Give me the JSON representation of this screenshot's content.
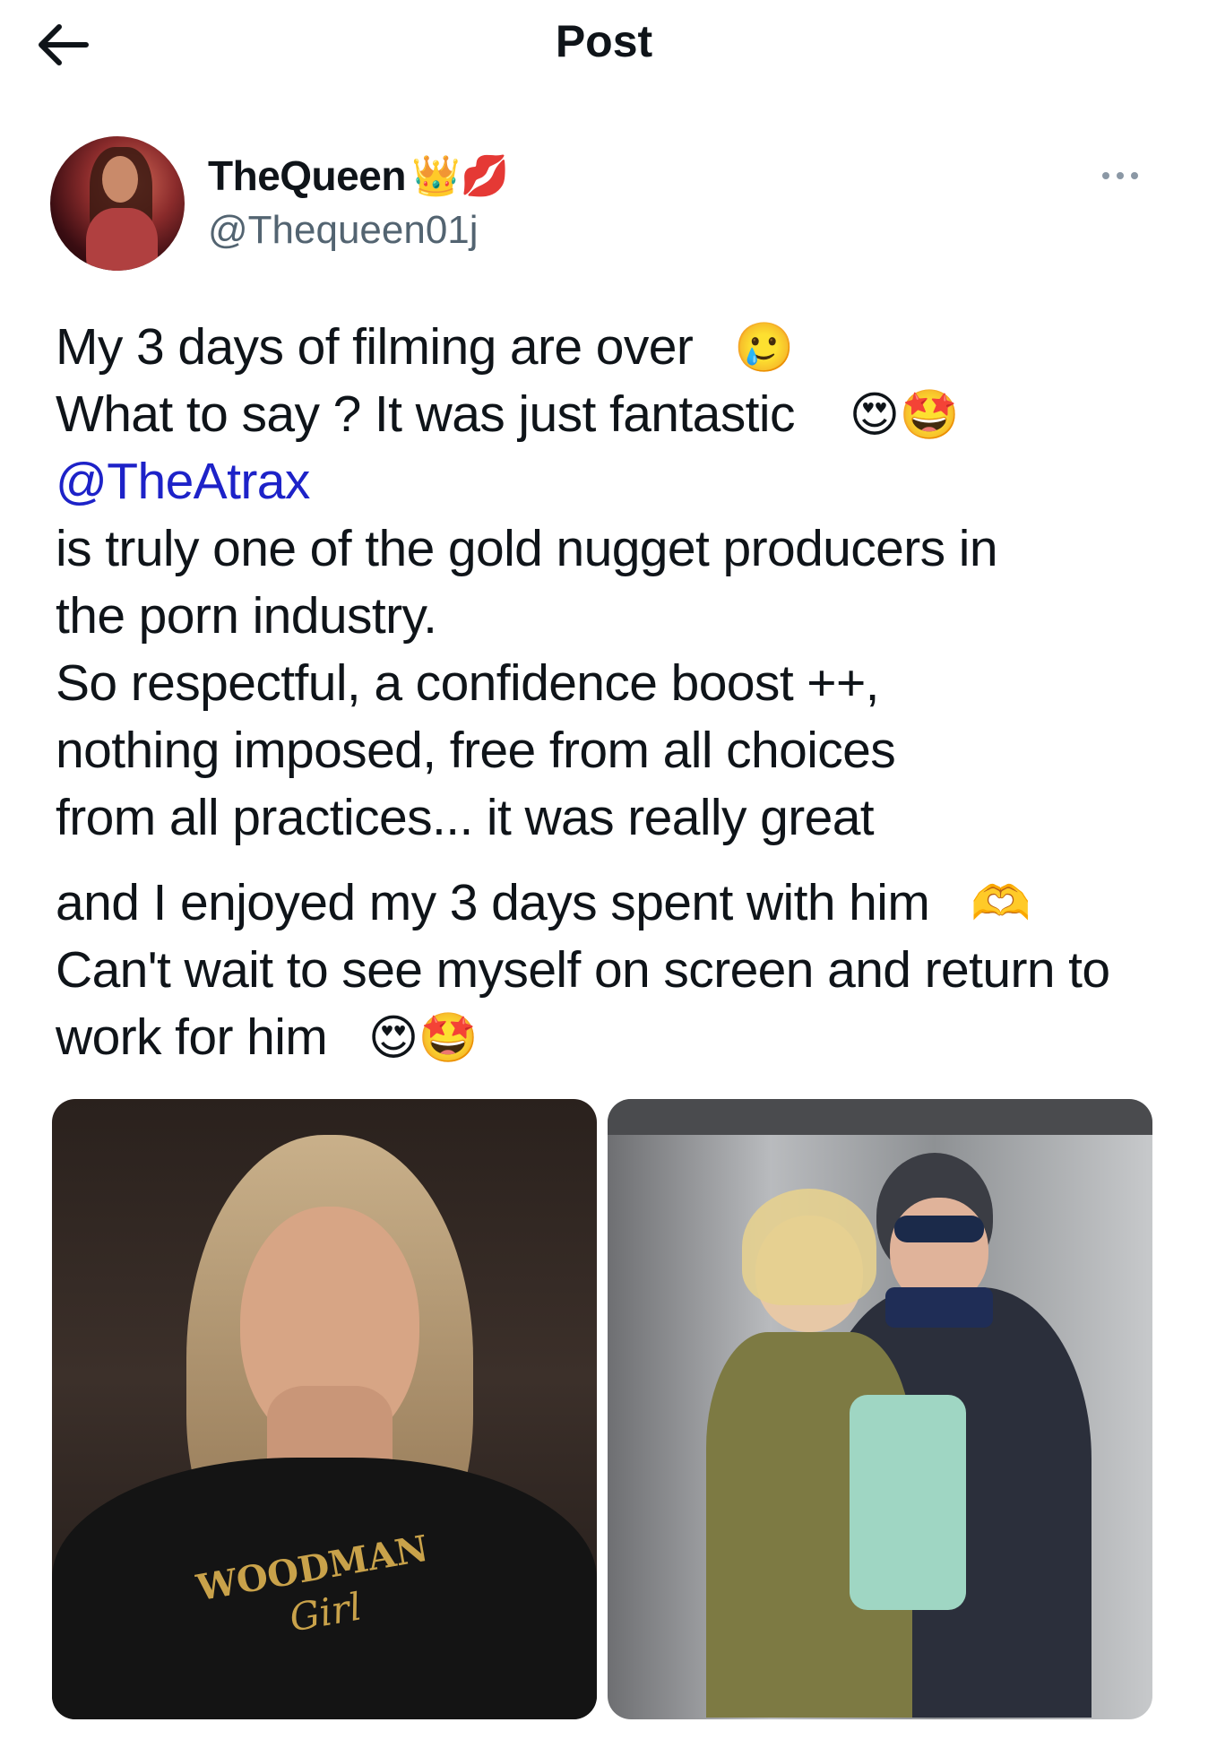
{
  "header": {
    "title": "Post",
    "back_icon": "arrow-left-icon"
  },
  "author": {
    "name": "TheQueen",
    "name_emojis": "👑💋",
    "handle": "@Thequeen01j",
    "more_icon": "more-horizontal-icon"
  },
  "post": {
    "lines": {
      "l1": "My 3 days of filming are over",
      "l1_emoji": "🥲",
      "l2": "What to say ? It was just fantastic",
      "l2_emoji": "😍🤩",
      "mention": "@TheAtrax",
      "l4": "is truly one of the gold nugget producers in",
      "l5": "the porn industry.",
      "l6": "So respectful, a confidence boost ++,",
      "l7": "nothing imposed, free from all choices",
      "l8": "from all practices... it was really great",
      "l9": "and I enjoyed my 3 days spent with him",
      "l9_emoji": "🫶",
      "l10": "Can't wait to see myself on screen and return to",
      "l11": "work for him",
      "l11_emoji": "😍🤩"
    }
  },
  "media": {
    "image1_shirt_text": "WOODMAN",
    "image1_shirt_script": "Girl"
  }
}
